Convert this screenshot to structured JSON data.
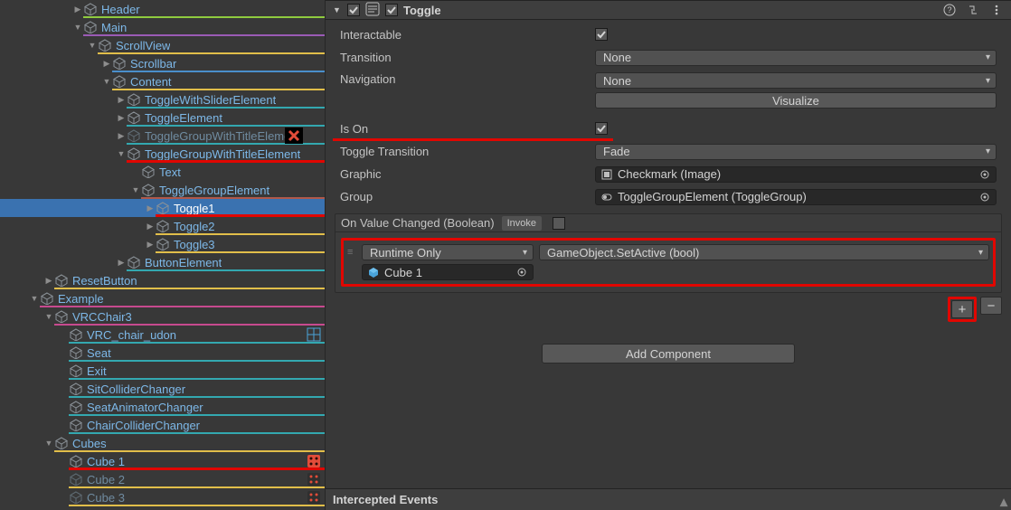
{
  "hierarchy": [
    {
      "d": 5,
      "f": "closed",
      "label": "Header",
      "ul": "#8FCB3F"
    },
    {
      "d": 5,
      "f": "open",
      "label": "Main",
      "ul": "#9A5BB5"
    },
    {
      "d": 6,
      "f": "open",
      "label": "ScrollView",
      "ul": "#E1BE4A"
    },
    {
      "d": 7,
      "f": "closed",
      "label": "Scrollbar",
      "ul": "#4A8FCB"
    },
    {
      "d": 7,
      "f": "open",
      "label": "Content",
      "ul": "#E1BE4A"
    },
    {
      "d": 8,
      "f": "closed",
      "label": "ToggleWithSliderElement",
      "ul": "#33A8B0"
    },
    {
      "d": 8,
      "f": "closed",
      "label": "ToggleElement",
      "ul": "#33A8B0"
    },
    {
      "d": 8,
      "f": "closed",
      "label": "ToggleGroupWithTitleElement",
      "ul": "#33A8B0",
      "greyed": true,
      "xbox": 315
    },
    {
      "d": 8,
      "f": "open",
      "label": "ToggleGroupWithTitleElement",
      "ul": "#33A8B0",
      "redUL": true
    },
    {
      "d": 9,
      "f": "none",
      "label": "Text",
      "ul": ""
    },
    {
      "d": 9,
      "f": "open",
      "label": "ToggleGroupElement",
      "ul": "#B0584A"
    },
    {
      "d": 10,
      "f": "closed",
      "label": "Toggle1",
      "ul": "#E1BE4A",
      "sel": true,
      "redUL": true
    },
    {
      "d": 10,
      "f": "closed",
      "label": "Toggle2",
      "ul": "#E1BE4A"
    },
    {
      "d": 10,
      "f": "closed",
      "label": "Toggle3",
      "ul": "#E1BE4A"
    },
    {
      "d": 8,
      "f": "closed",
      "label": "ButtonElement",
      "ul": "#33A8B0"
    },
    {
      "d": 3,
      "f": "closed",
      "label": "ResetButton",
      "ul": "#E1BE4A"
    },
    {
      "d": 2,
      "f": "open",
      "label": "Example",
      "ul": "#C74A8F"
    },
    {
      "d": 3,
      "f": "open",
      "label": "VRCChair3",
      "ul": "#C74A8F"
    },
    {
      "d": 4,
      "f": "none",
      "label": "VRC_chair_udon",
      "ul": "#33A8B0",
      "stripes": [
        "grid"
      ]
    },
    {
      "d": 4,
      "f": "none",
      "label": "Seat",
      "ul": "#33A8B0"
    },
    {
      "d": 4,
      "f": "none",
      "label": "Exit",
      "ul": "#33A8B0"
    },
    {
      "d": 4,
      "f": "none",
      "label": "SitColliderChanger",
      "ul": "#33A8B0"
    },
    {
      "d": 4,
      "f": "none",
      "label": "SeatAnimatorChanger",
      "ul": "#33A8B0"
    },
    {
      "d": 4,
      "f": "none",
      "label": "ChairColliderChanger",
      "ul": "#33A8B0"
    },
    {
      "d": 3,
      "f": "open",
      "label": "Cubes",
      "ul": "#E1BE4A"
    },
    {
      "d": 4,
      "f": "none",
      "label": "Cube 1",
      "ul": "#E1BE4A",
      "redUL": true,
      "stripes": [
        "die-red"
      ]
    },
    {
      "d": 4,
      "f": "none",
      "label": "Cube 2",
      "ul": "#E1BE4A",
      "greyed": true,
      "stripes": [
        "die-dark"
      ]
    },
    {
      "d": 4,
      "f": "none",
      "label": "Cube 3",
      "ul": "#E1BE4A",
      "greyed": true,
      "stripes": [
        "die-dark"
      ]
    }
  ],
  "component": {
    "title": "Toggle",
    "enabled": true,
    "props": {
      "interactable_label": "Interactable",
      "interactable_checked": true,
      "transition_label": "Transition",
      "transition_value": "None",
      "navigation_label": "Navigation",
      "navigation_value": "None",
      "visualize_label": "Visualize",
      "ison_label": "Is On",
      "ison_checked": true,
      "toggle_transition_label": "Toggle Transition",
      "toggle_transition_value": "Fade",
      "graphic_label": "Graphic",
      "graphic_value": "Checkmark (Image)",
      "group_label": "Group",
      "group_value": "ToggleGroupElement (ToggleGroup)"
    },
    "event": {
      "title": "On Value Changed (Boolean)",
      "invoke": "Invoke",
      "entry": {
        "mode": "Runtime Only",
        "fn": "GameObject.SetActive (bool)",
        "target": "Cube 1"
      }
    },
    "add_component_label": "Add Component"
  },
  "footer_section": "Intercepted Events"
}
